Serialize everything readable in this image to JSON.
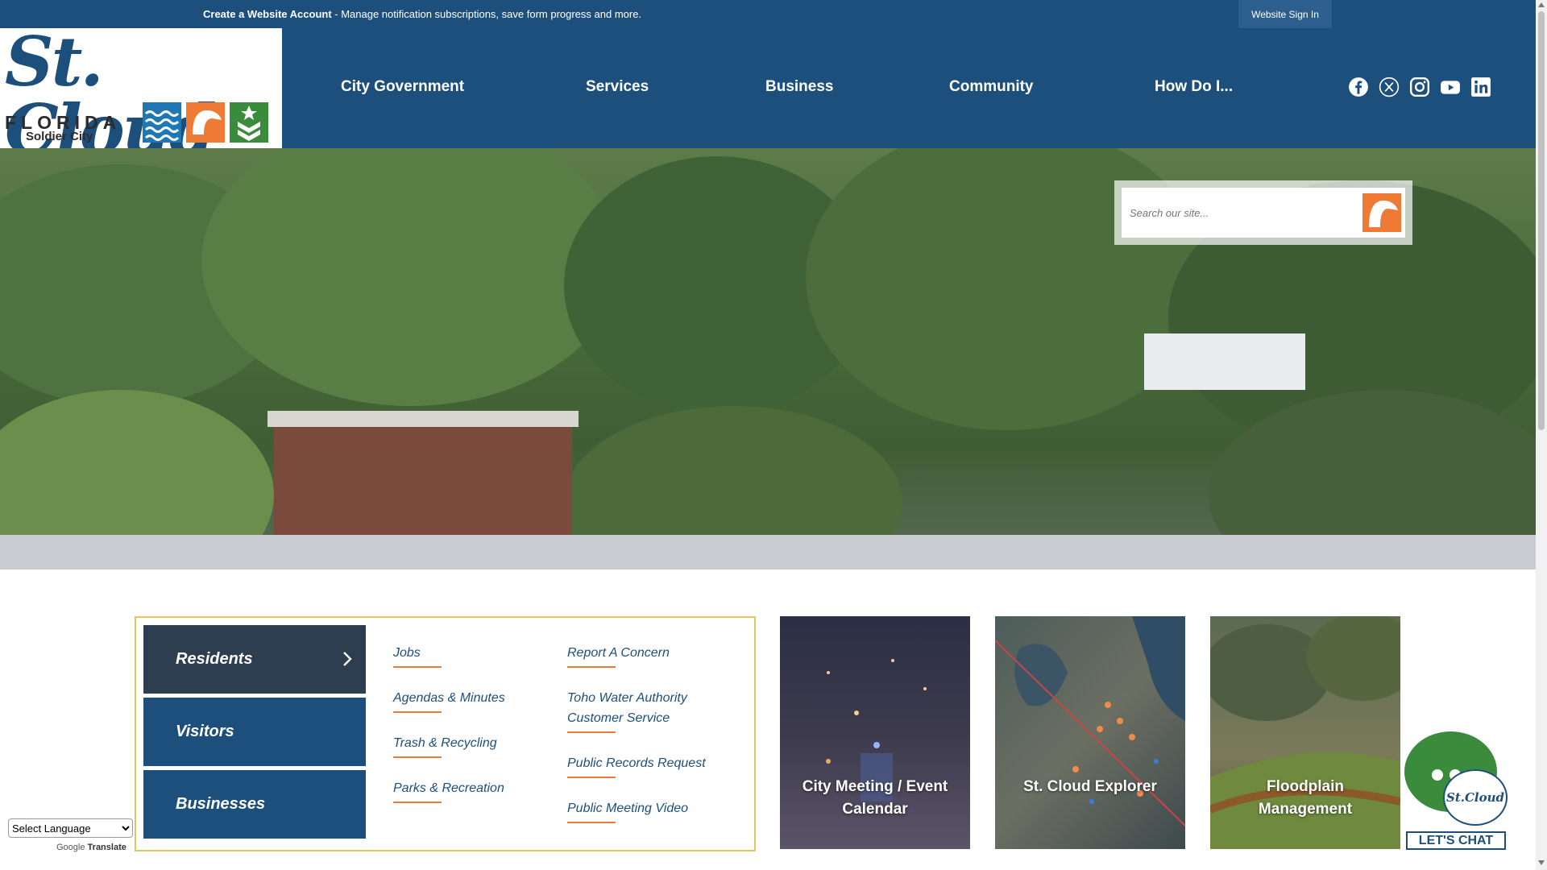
{
  "topbar": {
    "account_link": "Create a Website Account",
    "account_message": " - Manage notification subscriptions, save form progress and more.",
    "signin_label": "Website Sign In"
  },
  "logo": {
    "script": "St. Cloud",
    "state": "FLORIDA",
    "tagline": "Soldier City"
  },
  "nav": {
    "items": [
      {
        "label": "City Government"
      },
      {
        "label": "Services"
      },
      {
        "label": "Business"
      },
      {
        "label": "Community"
      },
      {
        "label": "How Do I..."
      }
    ]
  },
  "social": {
    "icons": [
      "facebook-icon",
      "x-icon",
      "instagram-icon",
      "youtube-icon",
      "linkedin-icon"
    ]
  },
  "search": {
    "placeholder": "Search our site..."
  },
  "audience": {
    "tabs": [
      {
        "label": "Residents",
        "active": true
      },
      {
        "label": "Visitors",
        "active": false
      },
      {
        "label": "Businesses",
        "active": false
      }
    ]
  },
  "quick_links": {
    "col1": [
      "Jobs",
      "Agendas & Minutes",
      "Trash & Recycling",
      "Parks & Recreation"
    ],
    "col2": [
      "Report A Concern",
      "Toho Water Authority Customer Service",
      "Public Records Request",
      "Public Meeting Video"
    ]
  },
  "cards": [
    {
      "label": "City Meeting / Event Calendar"
    },
    {
      "label": "St. Cloud Explorer"
    },
    {
      "label": "Floodplain Management"
    }
  ],
  "translate": {
    "select_label": "Select Language",
    "powered_brand": "Google",
    "powered_word": "Translate"
  },
  "chat": {
    "badge": "St.Cloud",
    "button": "LET'S CHAT"
  },
  "colors": {
    "brand_blue": "#1d4f7c",
    "accent_orange": "#ee7a36",
    "accent_green": "#3a8b3c",
    "panel_border": "#e3c564"
  }
}
